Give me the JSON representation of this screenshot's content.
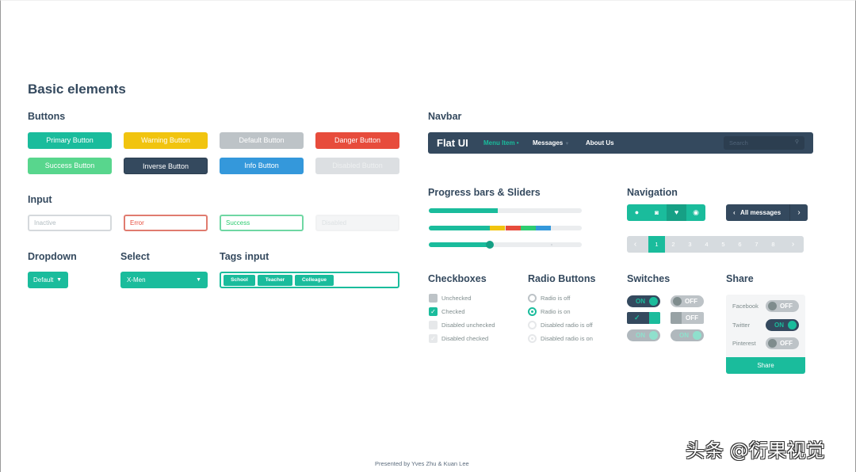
{
  "page": {
    "title": "Basic elements",
    "footer": "Presented by Yves Zhu & Kuan Lee",
    "watermark": "头条 @衍果视觉"
  },
  "colors": {
    "turquoise": "#1abc9c",
    "sunflower": "#f1c40f",
    "concrete": "#bdc3c7",
    "alizarin": "#e74c3c",
    "emerald": "#58d68d",
    "midnight": "#34495e",
    "peter_river": "#3498db",
    "clouds": "#ebedef"
  },
  "buttons": {
    "heading": "Buttons",
    "items": [
      {
        "label": "Primary Button",
        "variant": "primary"
      },
      {
        "label": "Warning Button",
        "variant": "warning"
      },
      {
        "label": "Default Button",
        "variant": "default"
      },
      {
        "label": "Danger Button",
        "variant": "danger"
      },
      {
        "label": "Success Button",
        "variant": "success"
      },
      {
        "label": "Inverse Button",
        "variant": "inverse"
      },
      {
        "label": "Info Button",
        "variant": "info"
      },
      {
        "label": "Disabled Button",
        "variant": "disabled"
      }
    ]
  },
  "input": {
    "heading": "Input",
    "fields": [
      {
        "placeholder": "Inactive",
        "state": "inactive"
      },
      {
        "value": "Error",
        "state": "error"
      },
      {
        "value": "Success",
        "state": "success"
      },
      {
        "placeholder": "Disabled",
        "state": "disabled"
      }
    ]
  },
  "dropdown": {
    "heading": "Dropdown",
    "label": "Default"
  },
  "select": {
    "heading": "Select",
    "value": "X-Men"
  },
  "tags_input": {
    "heading": "Tags input",
    "tags": [
      "School",
      "Teacher",
      "Colleague"
    ]
  },
  "navbar": {
    "heading": "Navbar",
    "brand": "Flat UI",
    "items": [
      {
        "label": "Menu Item",
        "active": true,
        "badge": "•"
      },
      {
        "label": "Messages",
        "dropdown": true
      },
      {
        "label": "About Us"
      }
    ],
    "search_placeholder": "Search",
    "search_icon": "search-icon"
  },
  "progress": {
    "heading": "Progress bars & Sliders",
    "bar1_percent": 45,
    "bar2_segments": [
      {
        "color": "#1abc9c",
        "percent": 40
      },
      {
        "color": "#f1c40f",
        "percent": 10
      },
      {
        "color": "#e74c3c",
        "percent": 10
      },
      {
        "color": "#2ecc71",
        "percent": 10
      },
      {
        "color": "#3498db",
        "percent": 10
      }
    ],
    "slider_percent": 40
  },
  "navigation": {
    "heading": "Navigation",
    "icon_group": [
      "clock-icon",
      "camera-icon",
      "heart-icon",
      "eye-icon"
    ],
    "active_icon_index": 2,
    "pager_label": "All messages",
    "pagination": {
      "prev": "‹",
      "next": "›",
      "pages": [
        "1",
        "2",
        "3",
        "4",
        "5",
        "6",
        "7",
        "8"
      ],
      "active": "1"
    }
  },
  "checkboxes": {
    "heading": "Checkboxes",
    "items": [
      {
        "label": "Unchecked",
        "checked": false,
        "disabled": false
      },
      {
        "label": "Checked",
        "checked": true,
        "disabled": false
      },
      {
        "label": "Disabled unchecked",
        "checked": false,
        "disabled": true
      },
      {
        "label": "Disabled checked",
        "checked": true,
        "disabled": true
      }
    ]
  },
  "radios": {
    "heading": "Radio Buttons",
    "items": [
      {
        "label": "Radio is off",
        "on": false,
        "disabled": false
      },
      {
        "label": "Radio is on",
        "on": true,
        "disabled": false
      },
      {
        "label": "Disabled radio is off",
        "on": false,
        "disabled": true
      },
      {
        "label": "Disabled radio is on",
        "on": true,
        "disabled": true
      }
    ]
  },
  "switches": {
    "heading": "Switches",
    "on_label": "ON",
    "off_label": "OFF",
    "check": "✓"
  },
  "share": {
    "heading": "Share",
    "rows": [
      {
        "label": "Facebook",
        "state": "OFF"
      },
      {
        "label": "Twitter",
        "state": "ON"
      },
      {
        "label": "Pinterest",
        "state": "OFF"
      }
    ],
    "button": "Share"
  }
}
